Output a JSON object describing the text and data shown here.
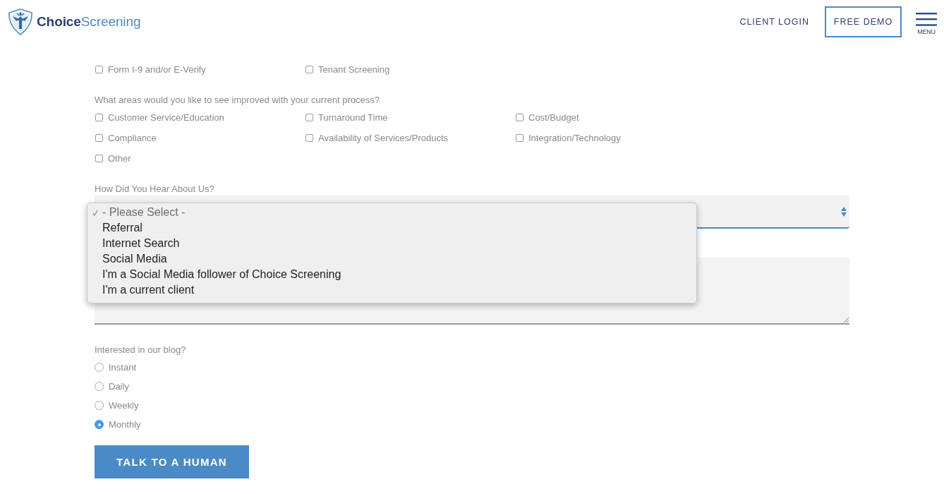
{
  "header": {
    "logo": {
      "wordmark": "**Choice**Screening"
    },
    "nav": [
      {
        "label": "CLIENT LOGIN",
        "kind": "link"
      },
      {
        "label": "FREE DEMO",
        "kind": "outlined"
      }
    ],
    "menu": {
      "label": "MENU"
    }
  },
  "form": {
    "services": [
      {
        "label": "Form I-9 and/or E-Verify",
        "checked": false
      },
      {
        "label": "Tenant Screening",
        "checked": false
      }
    ],
    "improve": {
      "question": "What areas would you like to see improved with your current process?",
      "options": [
        {
          "label": "Customer Service/Education",
          "checked": false
        },
        {
          "label": "Turnaround Time",
          "checked": false
        },
        {
          "label": "Cost/Budget",
          "checked": false
        },
        {
          "label": "Compliance",
          "checked": false
        },
        {
          "label": "Availability of Services/Products",
          "checked": false
        },
        {
          "label": "Integration/Technology",
          "checked": false
        },
        {
          "label": "Other",
          "checked": false
        }
      ]
    },
    "hear": {
      "label": "How Did You Hear About Us?",
      "expanded": true,
      "options": [
        {
          "label": "- Please Select -",
          "selected": true
        },
        {
          "label": "Referral",
          "selected": false
        },
        {
          "label": "Internet Search",
          "selected": false
        },
        {
          "label": "Social Media",
          "selected": false
        },
        {
          "label": "I'm a Social Media follower of Choice Screening",
          "selected": false
        },
        {
          "label": "I'm a current client",
          "selected": false
        }
      ]
    },
    "blog": {
      "question": "Interested in our blog?",
      "options": [
        {
          "label": "Instant",
          "selected": false
        },
        {
          "label": "Daily",
          "selected": false
        },
        {
          "label": "Weekly",
          "selected": false
        },
        {
          "label": "Monthly",
          "selected": true
        }
      ]
    },
    "submit": {
      "label": "TALK TO A HUMAN"
    }
  }
}
